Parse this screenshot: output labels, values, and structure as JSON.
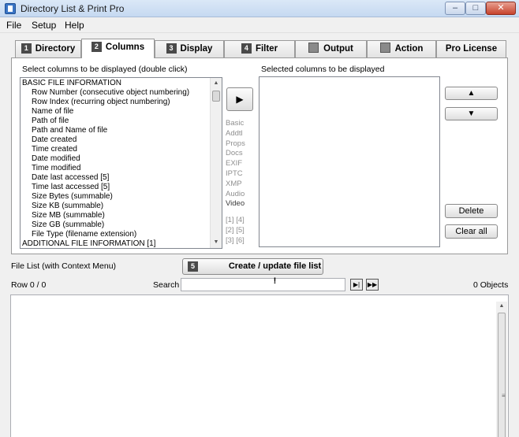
{
  "window": {
    "title": "Directory List & Print Pro",
    "buttons": {
      "minimize": "–",
      "maximize": "□",
      "close": "✕"
    }
  },
  "menu": [
    "File",
    "Setup",
    "Help"
  ],
  "tabs": [
    {
      "num": "1",
      "label": "Directory"
    },
    {
      "num": "2",
      "label": "Columns",
      "active": true
    },
    {
      "num": "3",
      "label": "Display"
    },
    {
      "num": "4",
      "label": "Filter"
    },
    {
      "icon": "document-icon",
      "label": "Output"
    },
    {
      "icon": "gear-icon",
      "label": "Action"
    },
    {
      "label": "Pro License"
    }
  ],
  "columns": {
    "available_label": "Select columns to be displayed (double click)",
    "selected_label": "Selected columns to be displayed",
    "available": [
      {
        "text": "BASIC FILE INFORMATION",
        "header": true
      },
      {
        "text": "Row Number  (consecutive object numbering)"
      },
      {
        "text": "Row Index  (recurring object numbering)"
      },
      {
        "text": "Name of file"
      },
      {
        "text": "Path of file"
      },
      {
        "text": "Path and Name of file"
      },
      {
        "text": "Date created"
      },
      {
        "text": "Time created"
      },
      {
        "text": "Date modified"
      },
      {
        "text": "Time modified"
      },
      {
        "text": "Date last accessed [5]"
      },
      {
        "text": "Time last accessed [5]"
      },
      {
        "text": "Size Bytes  (summable)"
      },
      {
        "text": "Size KB  (summable)"
      },
      {
        "text": "Size MB  (summable)"
      },
      {
        "text": "Size GB  (summable)"
      },
      {
        "text": "File Type  (filename extension)"
      },
      {
        "text": "ADDITIONAL FILE INFORMATION [1]",
        "header": true
      }
    ],
    "move_button": "▶",
    "groups": [
      {
        "text": "Basic"
      },
      {
        "text": "Addtl"
      },
      {
        "text": "Props"
      },
      {
        "text": "Docs"
      },
      {
        "text": "EXIF"
      },
      {
        "text": "IPTC"
      },
      {
        "text": "XMP"
      },
      {
        "text": "Audio"
      },
      {
        "text": "Video",
        "dark": true
      }
    ],
    "footnotes": [
      "[1]  [4]",
      "[2]  [5]",
      "[3]  [6]"
    ],
    "up_button": "▲",
    "down_button": "▼",
    "delete_button": "Delete",
    "clear_button": "Clear all"
  },
  "filelist": {
    "label": "File List (with Context Menu)",
    "step_num": "5",
    "create_button": "Create / update file list !",
    "row_text": "Row 0 / 0",
    "search_label": "Search",
    "search_value": "",
    "objects_text": "0 Objects",
    "next_button": "▶|",
    "fast_button": "▶▶"
  }
}
